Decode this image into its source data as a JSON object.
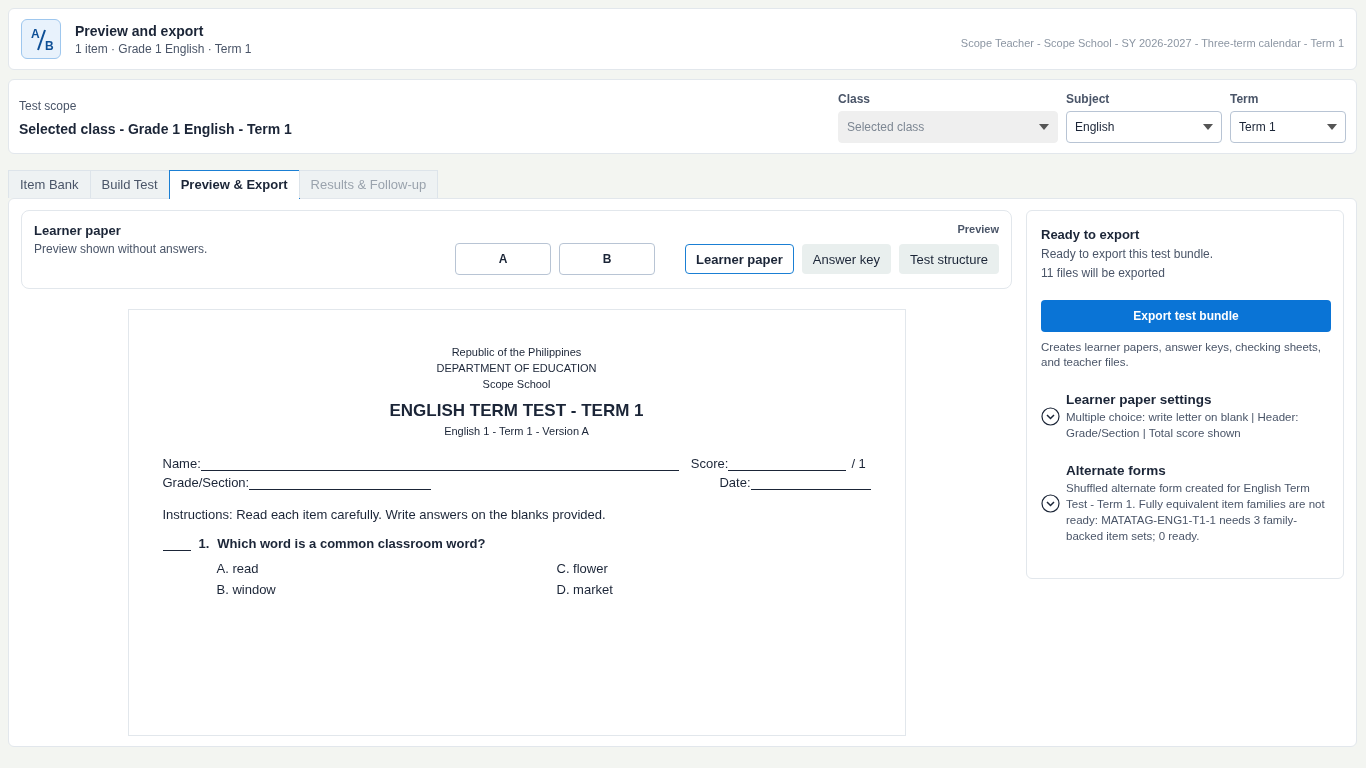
{
  "header": {
    "logo": {
      "top": "A",
      "bottom": "B"
    },
    "title": "Preview and export",
    "subtitle": "1 item · Grade 1 English · Term 1",
    "context": "Scope Teacher - Scope School - SY 2026-2027 - Three-term calendar - Term 1"
  },
  "scope": {
    "label": "Test scope",
    "value": "Selected class - Grade 1 English - Term 1",
    "fields": [
      {
        "label": "Class",
        "value": "Selected class",
        "disabled": true
      },
      {
        "label": "Subject",
        "value": "English",
        "disabled": false
      },
      {
        "label": "Term",
        "value": "Term 1",
        "disabled": false
      }
    ]
  },
  "tabs": [
    {
      "label": "Item Bank",
      "selected": false,
      "disabled": false
    },
    {
      "label": "Build Test",
      "selected": false,
      "disabled": false
    },
    {
      "label": "Preview & Export",
      "selected": true,
      "disabled": false
    },
    {
      "label": "Results & Follow-up",
      "selected": false,
      "disabled": true
    }
  ],
  "preview": {
    "title": "Learner paper",
    "note": "Preview shown without answers.",
    "caption": "Preview",
    "versions": [
      "A",
      "B"
    ],
    "views": [
      {
        "label": "Learner paper",
        "selected": true
      },
      {
        "label": "Answer key",
        "selected": false
      },
      {
        "label": "Test structure",
        "selected": false
      }
    ]
  },
  "paper": {
    "header_lines": [
      "Republic of the Philippines",
      "DEPARTMENT OF EDUCATION",
      "Scope School"
    ],
    "title": "ENGLISH TERM TEST - TERM 1",
    "subtitle": "English 1 - Term 1 - Version A",
    "name_label": "Name:",
    "score_label": "Score:",
    "score_total": "/ 1",
    "grade_label": "Grade/Section:",
    "date_label": "Date:",
    "instructions": "Instructions: Read each item carefully. Write answers on the blanks provided.",
    "questions": [
      {
        "number": "1.",
        "text": "Which word is a common classroom word?",
        "choices": [
          "A. read",
          "C. flower",
          "B. window",
          "D. market"
        ]
      }
    ]
  },
  "export": {
    "title": "Ready to export",
    "status": "Ready to export this test bundle.",
    "count": "11 files will be exported",
    "button": "Export test bundle",
    "note": "Creates learner papers, answer keys, checking sheets, and teacher files.",
    "sections": [
      {
        "title": "Learner paper settings",
        "text": "Multiple choice: write letter on blank | Header: Grade/Section | Total score shown"
      },
      {
        "title": "Alternate forms",
        "text": "Shuffled alternate form created for English Term Test - Term 1. Fully equivalent item families are not ready: MATATAG-ENG1-T1-1 needs 3 family-backed item sets; 0 ready."
      }
    ]
  }
}
